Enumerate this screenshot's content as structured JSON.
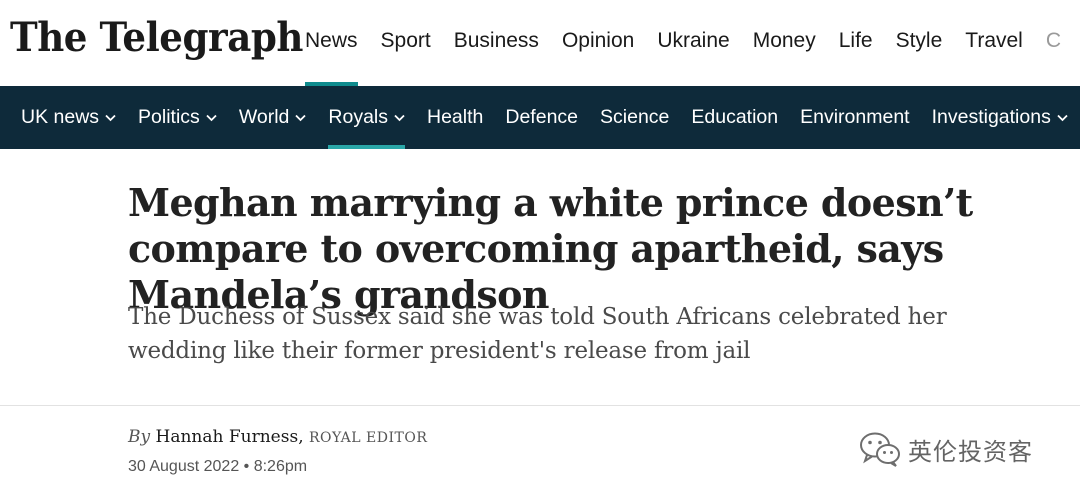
{
  "brand": {
    "logo_text": "The Telegraph"
  },
  "top_nav": {
    "items": [
      {
        "label": "News",
        "active": true
      },
      {
        "label": "Sport"
      },
      {
        "label": "Business"
      },
      {
        "label": "Opinion"
      },
      {
        "label": "Ukraine"
      },
      {
        "label": "Money"
      },
      {
        "label": "Life"
      },
      {
        "label": "Style"
      },
      {
        "label": "Travel"
      },
      {
        "label": "C"
      }
    ]
  },
  "section_nav": {
    "items": [
      {
        "label": "UK news",
        "dropdown": true
      },
      {
        "label": "Politics",
        "dropdown": true
      },
      {
        "label": "World",
        "dropdown": true
      },
      {
        "label": "Royals",
        "dropdown": true,
        "active": true
      },
      {
        "label": "Health"
      },
      {
        "label": "Defence"
      },
      {
        "label": "Science"
      },
      {
        "label": "Education"
      },
      {
        "label": "Environment"
      },
      {
        "label": "Investigations",
        "dropdown": true
      }
    ]
  },
  "article": {
    "headline": "Meghan marrying a white prince doesn’t compare to overcoming apartheid, says Mandela’s grandson",
    "standfirst": "The Duchess of Sussex said she was told South Africans celebrated her wedding like their former president's release from jail",
    "byline_prefix": "By",
    "author": "Hannah Furness,",
    "author_role": "ROYAL EDITOR",
    "date": "30 August 2022 • 8:26pm"
  },
  "watermark": {
    "text": "英伦投资客",
    "icon": "wechat-icon"
  },
  "colors": {
    "section_bar_bg": "#0e2a3a",
    "accent_teal": "#0f8b8d",
    "text_dark": "#1a1a1a"
  }
}
